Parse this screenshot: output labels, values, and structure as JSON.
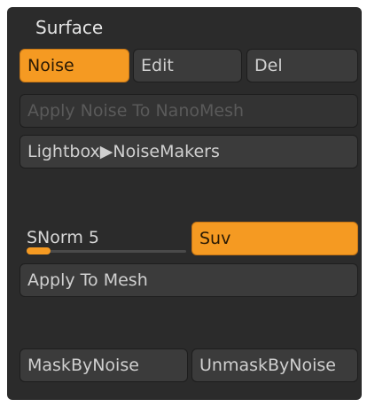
{
  "panel": {
    "title": "Surface"
  },
  "buttons": {
    "noise": "Noise",
    "edit": "Edit",
    "del": "Del",
    "apply_noise_nanomesh": "Apply Noise To NanoMesh",
    "lightbox_noisemakers": "Lightbox▶NoiseMakers",
    "suv": "Suv",
    "apply_to_mesh": "Apply To Mesh",
    "mask_by_noise": "MaskByNoise",
    "unmask_by_noise": "UnmaskByNoise"
  },
  "slider": {
    "label": "SNorm 5",
    "value": 5,
    "fill_fraction": 0.15
  },
  "colors": {
    "accent": "#f59a22",
    "panel_bg": "#2b2b2b",
    "button_bg": "#3b3b3b",
    "text": "#d0d0d0",
    "disabled_text": "#5a5a5a"
  }
}
